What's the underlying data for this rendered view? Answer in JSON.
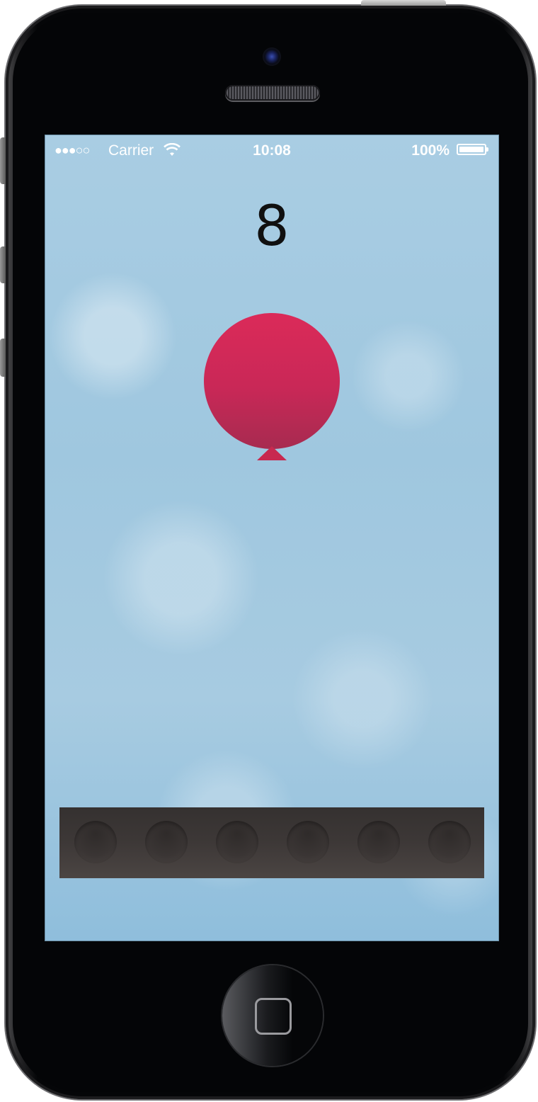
{
  "status_bar": {
    "signal": "●●●○○",
    "carrier": "Carrier",
    "time": "10:08",
    "battery": "100%"
  },
  "game": {
    "score": "8",
    "balloon_color": "#cf2a57",
    "tray_slots": 6,
    "tray_color": "#3d3837"
  },
  "icons": [
    "wifi-icon",
    "battery-icon",
    "home-button-icon"
  ]
}
